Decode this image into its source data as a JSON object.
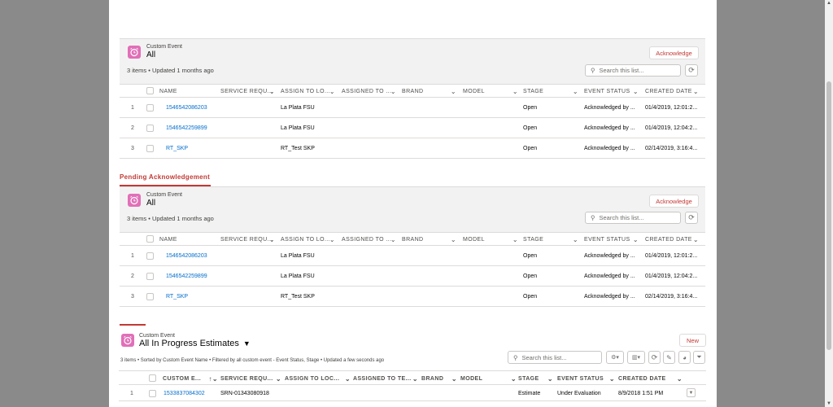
{
  "cards": [
    {
      "object_label": "Custom Event",
      "list_name": "All",
      "meta": "3 items • Updated 1 months ago",
      "action_button": "Acknowledge",
      "search_placeholder": "Search this list...",
      "columns": [
        "NAME",
        "SERVICE REQU...",
        "ASSIGN TO LO...",
        "ASSIGNED TO ...",
        "BRAND",
        "MODEL",
        "STAGE",
        "EVENT STATUS",
        "CREATED DATE"
      ],
      "rows": [
        {
          "num": "1",
          "name": "1546542086203",
          "location": "La Plata FSU",
          "stage": "Open",
          "status": "Acknowledged by ...",
          "created": "01/4/2019, 12:01:2..."
        },
        {
          "num": "2",
          "name": "1546542259899",
          "location": "La Plata FSU",
          "stage": "Open",
          "status": "Acknowledged by ...",
          "created": "01/4/2019, 12:04:2..."
        },
        {
          "num": "3",
          "name": "RT_SKP",
          "location": "RT_Test SKP",
          "stage": "Open",
          "status": "Acknowledged by ...",
          "created": "02/14/2019, 3:16:4..."
        }
      ]
    },
    {
      "object_label": "Custom Event",
      "list_name": "All",
      "meta": "3 items • Updated 1 months ago",
      "action_button": "Acknowledge",
      "search_placeholder": "Search this list...",
      "columns": [
        "NAME",
        "SERVICE REQU...",
        "ASSIGN TO LO...",
        "ASSIGNED TO ...",
        "BRAND",
        "MODEL",
        "STAGE",
        "EVENT STATUS",
        "CREATED DATE"
      ],
      "rows": [
        {
          "num": "1",
          "name": "1546542086203",
          "location": "La Plata FSU",
          "stage": "Open",
          "status": "Acknowledged by ...",
          "created": "01/4/2019, 12:01:2..."
        },
        {
          "num": "2",
          "name": "1546542259899",
          "location": "La Plata FSU",
          "stage": "Open",
          "status": "Acknowledged by ...",
          "created": "01/4/2019, 12:04:2..."
        },
        {
          "num": "3",
          "name": "RT_SKP",
          "location": "RT_Test SKP",
          "stage": "Open",
          "status": "Acknowledged by ...",
          "created": "02/14/2019, 3:16:4..."
        }
      ]
    }
  ],
  "tab_label": "Pending Acknowledgement",
  "estimates": {
    "object_label": "Custom Event",
    "list_name": "All In Progress Estimates",
    "meta": "3 items • Sorted by Custom Event Name • Filtered by all custom event - Event Status, Stage • Updated a few seconds ago",
    "new_button": "New",
    "search_placeholder": "Search this list...",
    "columns": [
      "CUSTOM E...",
      "SERVICE REQU...",
      "ASSIGN TO LOC...",
      "ASSIGNED TO TE...",
      "BRAND",
      "MODEL",
      "STAGE",
      "EVENT STATUS",
      "CREATED DATE"
    ],
    "rows": [
      {
        "num": "1",
        "name": "1533837084302",
        "service": "SRN-01343080918",
        "stage": "Estimate",
        "status": "Under Evaluation",
        "created": "8/9/2018 1:51 PM"
      }
    ]
  },
  "icons": {
    "object": "alarm-clock-icon",
    "search": "search-icon",
    "refresh": "refresh-icon",
    "dropdown": "chevron-down-icon"
  },
  "colors": {
    "accent": "#c23934",
    "link": "#006dcc",
    "object_icon": "#e16fb8"
  }
}
